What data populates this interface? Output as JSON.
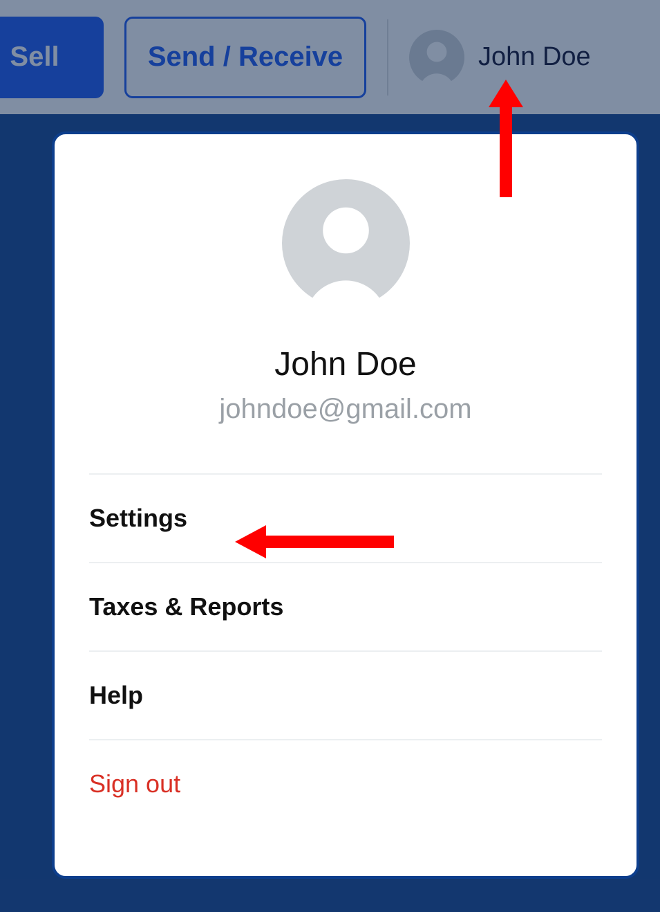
{
  "topbar": {
    "sell_label": "Sell",
    "send_receive_label": "Send / Receive",
    "profile_name": "John Doe"
  },
  "profile_card": {
    "name": "John Doe",
    "email": "johndoe@gmail.com"
  },
  "menu": {
    "settings": "Settings",
    "taxes_reports": "Taxes & Reports",
    "help": "Help",
    "sign_out": "Sign out"
  },
  "colors": {
    "brand": "#1652f0",
    "danger": "#d93025",
    "bg": "#0d3e8c"
  }
}
